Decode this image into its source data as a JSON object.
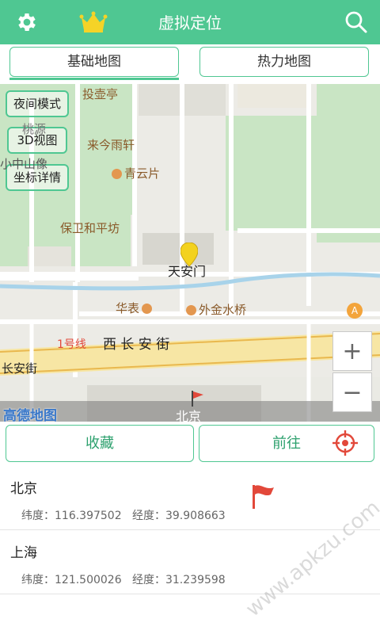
{
  "header": {
    "title": "虚拟定位",
    "icons": [
      "gear-icon",
      "crown-icon",
      "search-icon"
    ],
    "colors": {
      "primary": "#4fc792",
      "crown": "#f5d327"
    }
  },
  "tabs": [
    {
      "label": "基础地图",
      "selected": true
    },
    {
      "label": "热力地图",
      "selected": false
    }
  ],
  "map": {
    "buttons": [
      "夜间模式",
      "3D视图",
      "坐标详情"
    ],
    "marker_label": "天安门",
    "pois": {
      "touhuting": "投壶亭",
      "taoyuan": "桃源",
      "laijinyuxuan": "来今雨轩",
      "zhongshan": "小中山像",
      "qingyunpian": "青云片",
      "baowei": "保卫和平坊",
      "huabiao": "华表",
      "jinshuiqiao": "外金水桥",
      "subway_line": "1号线",
      "street": "西 长 安 街",
      "street_left": "长安街",
      "beijing": "北京"
    },
    "poi_badge": "A",
    "zoom_in": "+",
    "zoom_out": "−",
    "logo": "高德地图"
  },
  "actions": {
    "favorite": "收藏",
    "goto": "前往",
    "target_icon": "crosshair-icon"
  },
  "locations": [
    {
      "city": "北京",
      "lat_label": "纬度：",
      "lat": "116.397502",
      "lng_label": "经度：",
      "lng": "39.908663"
    },
    {
      "city": "上海",
      "lat_label": "纬度：",
      "lat": "121.500026",
      "lng_label": "经度：",
      "lng": "31.239598"
    }
  ],
  "watermark": "www.apkzu.com"
}
